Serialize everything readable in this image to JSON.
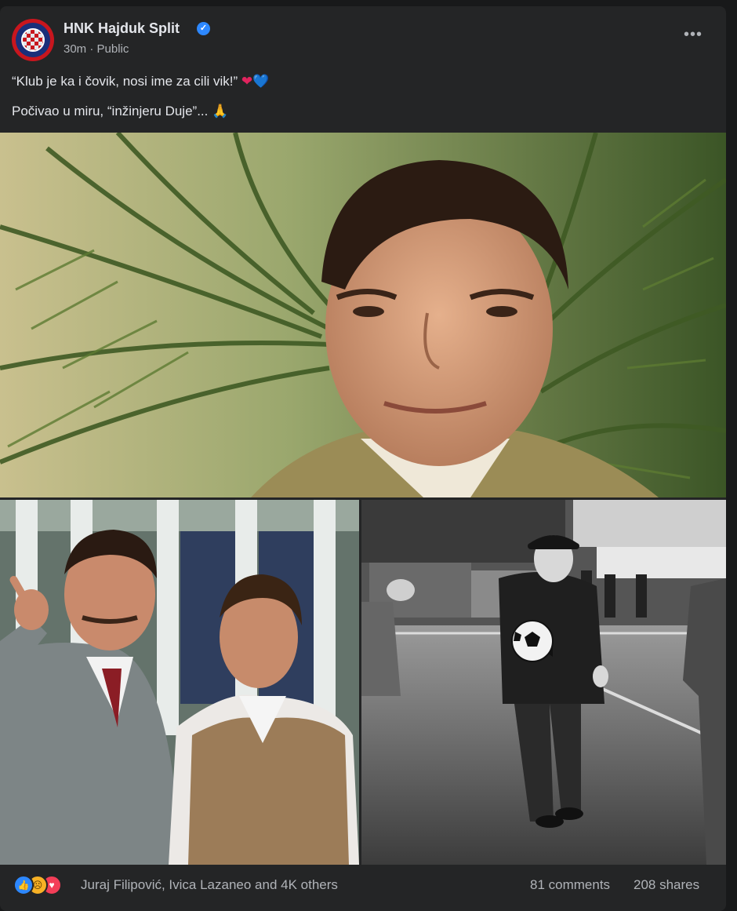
{
  "post": {
    "page_name": "HNK Hajduk Split",
    "time": "30m",
    "separator": "·",
    "privacy": "Public",
    "more_label": "•••",
    "text_line1": "“Klub je ka i čovik, nosi ime za cili vik!”",
    "text_line1_emoji": [
      "❤",
      "💙"
    ],
    "text_line2": "Počivao u miru, “inžinjeru Duje”...",
    "text_line2_emoji": "🙏"
  },
  "photos": [
    {
      "name": "portrait-young-man-palms",
      "style": "color film still"
    },
    {
      "name": "two-men-pointing",
      "style": "color film still"
    },
    {
      "name": "old-man-with-football",
      "style": "black and white photo"
    }
  ],
  "footer": {
    "reaction_icons": [
      "like-icon",
      "sad-icon",
      "love-icon"
    ],
    "reactors": "Juraj Filipović, Ivica Lazaneo and 4K others",
    "comments": "81 comments",
    "shares": "208 shares"
  },
  "colors": {
    "background": "#18191a",
    "card": "#242526",
    "primary_text": "#e4e6eb",
    "secondary_text": "#b0b3b8",
    "verified_blue": "#2d88ff"
  }
}
